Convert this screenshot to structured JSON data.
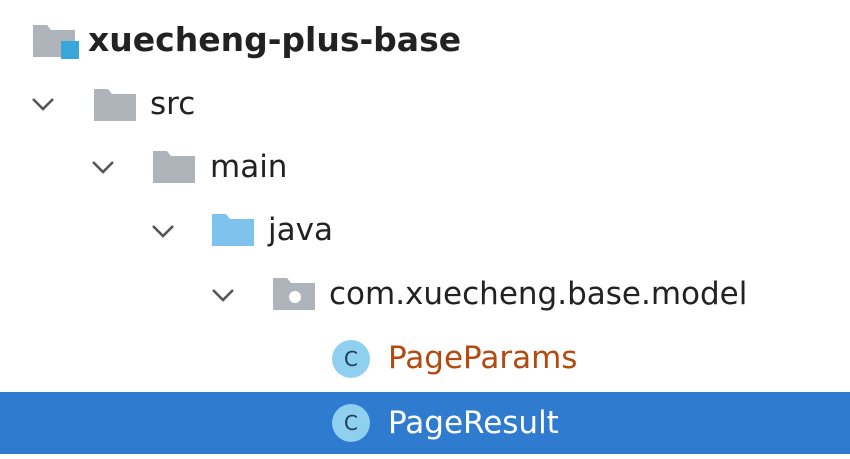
{
  "tree": {
    "root": {
      "label": "xuecheng-plus-base",
      "icon": "module-folder-icon"
    },
    "src": {
      "label": "src",
      "icon": "folder-icon",
      "expanded": true
    },
    "main": {
      "label": "main",
      "icon": "folder-icon",
      "expanded": true
    },
    "java": {
      "label": "java",
      "icon": "source-root-folder-icon",
      "expanded": true
    },
    "package": {
      "label": "com.xuecheng.base.model",
      "icon": "package-icon",
      "expanded": true
    },
    "class1": {
      "label": "PageParams",
      "icon": "class-icon",
      "badge": "C"
    },
    "class2": {
      "label": "PageResult",
      "icon": "class-icon",
      "badge": "C",
      "selected": true
    }
  },
  "colors": {
    "selection": "#2f7bd0",
    "folder_gray": "#aeb4ba",
    "folder_blue": "#7ec3ee",
    "module_accent": "#3aa7dc",
    "class_badge": "#8fd0f0",
    "modified_text": "#b34a10"
  }
}
